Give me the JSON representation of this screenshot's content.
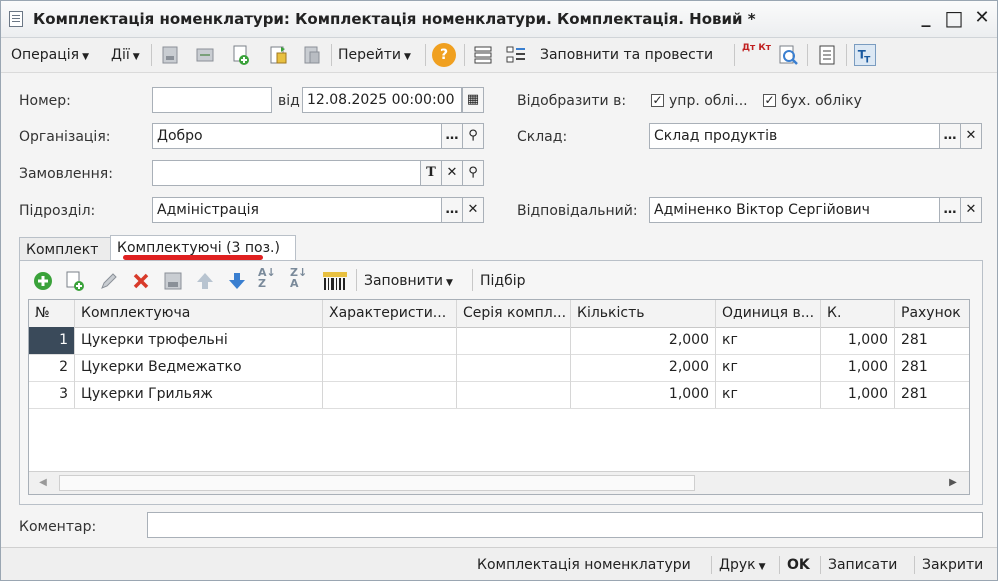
{
  "window": {
    "title": "Комплектація номенклатури: Комплектація номенклатури. Комплектація. Новий *",
    "minimize": "_",
    "maximize": "□",
    "close": "✕"
  },
  "toolbar": {
    "operation_label": "Операція",
    "actions_label": "Дії",
    "goto_label": "Перейти",
    "help_label": "?",
    "fill_and_post_label": "Заповнити та провести",
    "dt_kt_label": "Дт Кт"
  },
  "form": {
    "number_label": "Номер:",
    "number_value": "",
    "date_prefix": "від",
    "date_value": "12.08.2025 00:00:00",
    "reflect_label": "Відобразити в:",
    "mgmt_accounting_label": "упр. облі...",
    "mgmt_accounting_checked": true,
    "bookkeeping_label": "бух. обліку",
    "bookkeeping_checked": true,
    "organization_label": "Організація:",
    "organization_value": "Добро",
    "warehouse_label": "Склад:",
    "warehouse_value": "Склад продуктів",
    "order_label": "Замовлення:",
    "order_value": "",
    "department_label": "Підрозділ:",
    "department_value": "Адміністрація",
    "responsible_label": "Відповідальний:",
    "responsible_value": "Адміненко Віктор Сергійович",
    "comment_label": "Коментар:",
    "comment_value": ""
  },
  "tabs": [
    {
      "label": "Комплект"
    },
    {
      "label": "Комплектуючі (3 поз.)"
    }
  ],
  "grid_toolbar": {
    "fill_label": "Заповнити",
    "pick_label": "Підбір"
  },
  "table": {
    "columns": [
      "№",
      "Комплектуюча",
      "Характеристи...",
      "Серія компл...",
      "Кількість",
      "Одиниця в...",
      "К.",
      "Рахунок"
    ],
    "rows": [
      {
        "n": "1",
        "item": "Цукерки трюфельні",
        "characteristic": "",
        "series": "",
        "qty": "2,000",
        "unit": "кг",
        "k": "1,000",
        "account": "281"
      },
      {
        "n": "2",
        "item": "Цукерки Ведмежатко",
        "characteristic": "",
        "series": "",
        "qty": "2,000",
        "unit": "кг",
        "k": "1,000",
        "account": "281"
      },
      {
        "n": "3",
        "item": "Цукерки Грильяж",
        "characteristic": "",
        "series": "",
        "qty": "1,000",
        "unit": "кг",
        "k": "1,000",
        "account": "281"
      }
    ]
  },
  "statusbar": {
    "doc_label": "Комплектація номенклатури",
    "print_label": "Друк",
    "ok_label": "OK",
    "save_label": "Записати",
    "close_label": "Закрити"
  },
  "colors": {
    "accent_red": "#e02020",
    "add_green": "#3aa23a",
    "delete_red": "#d83a2a",
    "arrow_blue": "#3a7fd0"
  }
}
